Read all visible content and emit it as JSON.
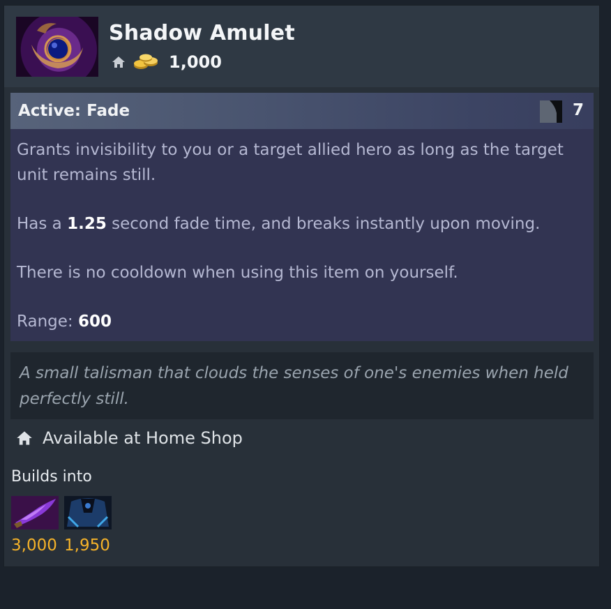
{
  "item": {
    "name": "Shadow Amulet",
    "cost": "1,000",
    "icon": "shadow-amulet-icon"
  },
  "active": {
    "title": "Active: Fade",
    "mana_cost": "7",
    "desc1": "Grants invisibility to you or a target allied hero as long as the target unit remains still.",
    "desc2_pre": "Has a ",
    "desc2_value": "1.25",
    "desc2_post": " second fade time, and breaks instantly upon moving.",
    "desc3": "There is no cooldown when using this item on yourself.",
    "range_label": "Range: ",
    "range_value": "600"
  },
  "lore": "A small talisman that clouds the senses of one's enemies when held perfectly still.",
  "availability": "Available at Home Shop",
  "builds_into": {
    "label": "Builds into",
    "items": [
      {
        "icon": "purple-blade-icon",
        "cost": "3,000"
      },
      {
        "icon": "blue-cape-icon",
        "cost": "1,950"
      }
    ]
  },
  "colors": {
    "gold": "#f6b329",
    "active_bg": "#323452",
    "card_bg": "#283039"
  }
}
